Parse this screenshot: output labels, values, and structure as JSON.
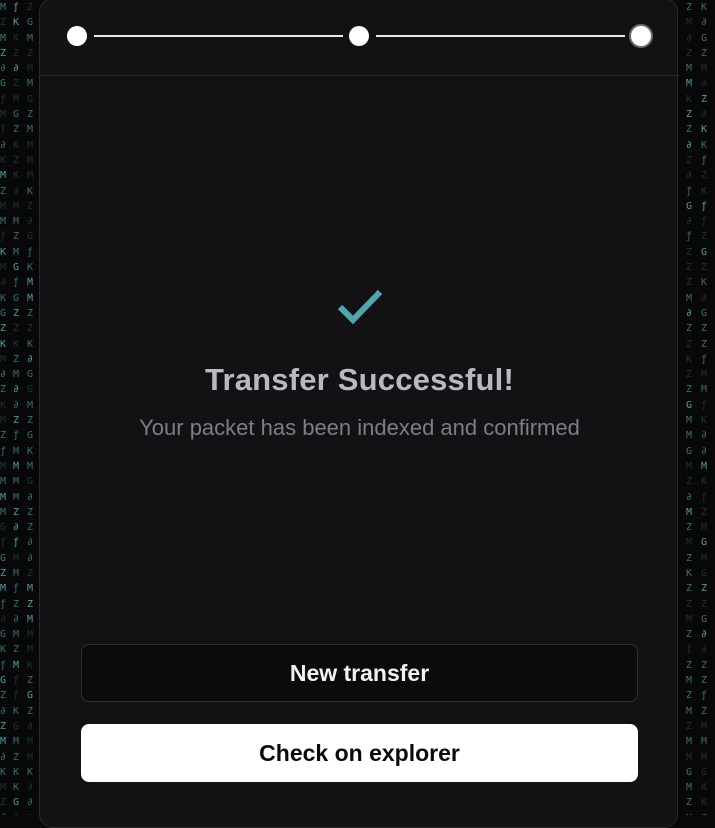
{
  "stepper": {
    "steps": [
      "step-1",
      "step-2",
      "step-3"
    ],
    "current_step": 3,
    "total_steps": 3
  },
  "status": {
    "title": "Transfer Successful!",
    "message": "Your packet has been indexed and confirmed"
  },
  "actions": {
    "new_transfer_label": "New transfer",
    "explorer_label": "Check on explorer"
  },
  "colors": {
    "accent": "#4fa6ad",
    "card_bg": "#121214",
    "page_bg": "#080809"
  }
}
